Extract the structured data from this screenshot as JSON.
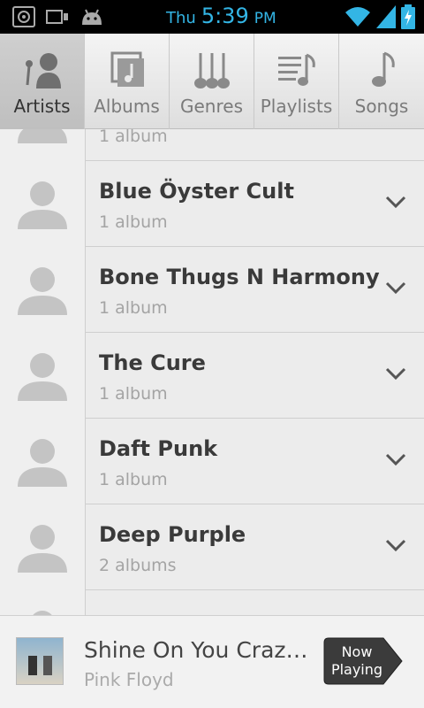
{
  "status": {
    "day": "Thu",
    "time": "5:39",
    "ampm": "PM",
    "accent": "#33b5e5"
  },
  "tabs": [
    {
      "label": "Artists",
      "icon": "artist-icon",
      "selected": true
    },
    {
      "label": "Albums",
      "icon": "album-icon",
      "selected": false
    },
    {
      "label": "Genres",
      "icon": "genres-icon",
      "selected": false
    },
    {
      "label": "Playlists",
      "icon": "playlist-icon",
      "selected": false
    },
    {
      "label": "Songs",
      "icon": "song-icon",
      "selected": false
    }
  ],
  "list": {
    "partial_top_count": "1 album",
    "items": [
      {
        "name": "Blue Öyster Cult",
        "count": "1 album"
      },
      {
        "name": "Bone Thugs N Harmony",
        "count": "1 album"
      },
      {
        "name": "The Cure",
        "count": "1 album"
      },
      {
        "name": "Daft Punk",
        "count": "1 album"
      },
      {
        "name": "Deep Purple",
        "count": "2 albums"
      }
    ]
  },
  "now_playing": {
    "title": "Shine On You Craz…",
    "artist": "Pink Floyd",
    "button_label": "Now Playing"
  }
}
